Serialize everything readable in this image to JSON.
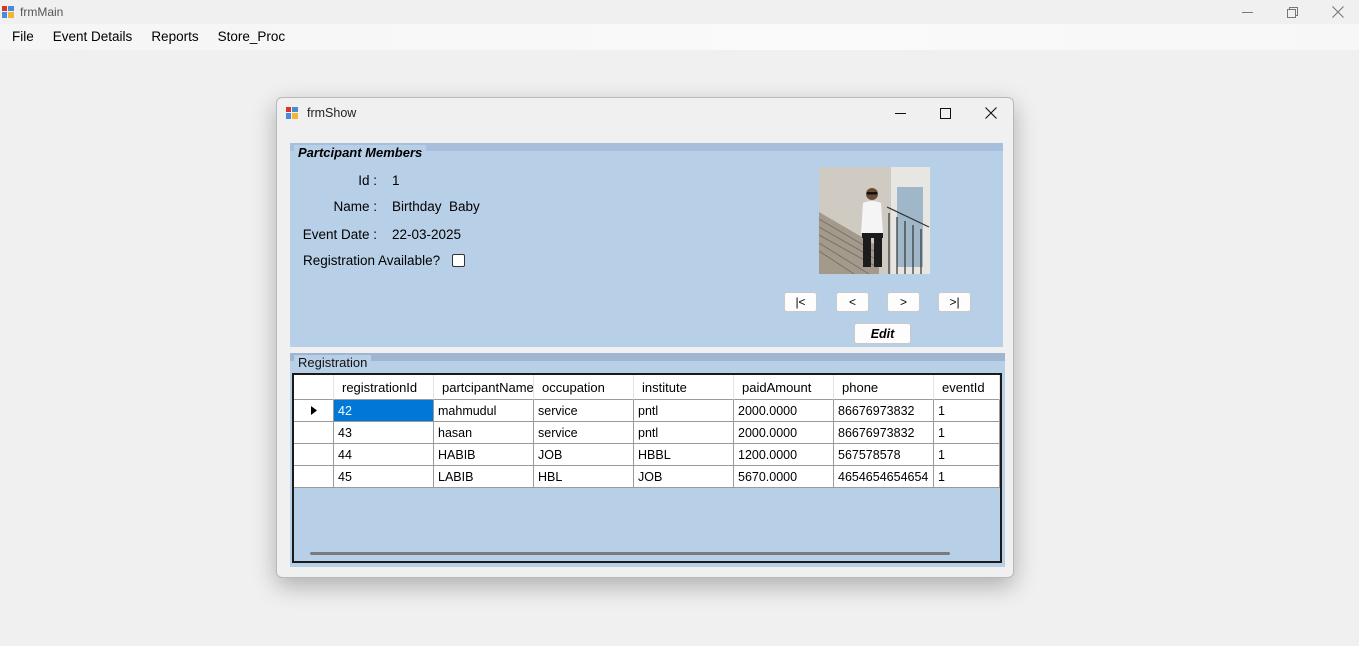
{
  "main_window": {
    "title": "frmMain",
    "menu": [
      "File",
      "Event Details",
      "Reports",
      "Store_Proc"
    ]
  },
  "child_window": {
    "title": "frmShow"
  },
  "participant_group": {
    "legend": "Partcipant Members",
    "id_label": "Id :",
    "id_value": "1",
    "name_label": "Name :",
    "name_value": "Birthday  Baby",
    "event_date_label": "Event Date :",
    "event_date_value": "22-03-2025",
    "registration_label": "Registration Available?",
    "registration_checked": false,
    "nav": {
      "first": "|<",
      "prev": "<",
      "next": ">",
      "last": ">|"
    },
    "edit_label": "Edit"
  },
  "registration_group": {
    "legend": "Registration",
    "columns": [
      "registrationId",
      "partcipantName",
      "occupation",
      "institute",
      "paidAmount",
      "phone",
      "eventId"
    ],
    "rows": [
      [
        "42",
        "mahmudul",
        "service",
        "pntl",
        "2000.0000",
        "86676973832",
        "1"
      ],
      [
        "43",
        "hasan",
        "service",
        "pntl",
        "2000.0000",
        "86676973832",
        "1"
      ],
      [
        "44",
        "HABIB",
        "JOB",
        "HBBL",
        "1200.0000",
        "567578578",
        "1"
      ],
      [
        "45",
        "LABIB",
        "HBL",
        "JOB",
        "5670.0000",
        "4654654654654",
        "1"
      ]
    ]
  },
  "colors": {
    "group_background": "#b8cfe8",
    "selection": "#0078d7"
  }
}
